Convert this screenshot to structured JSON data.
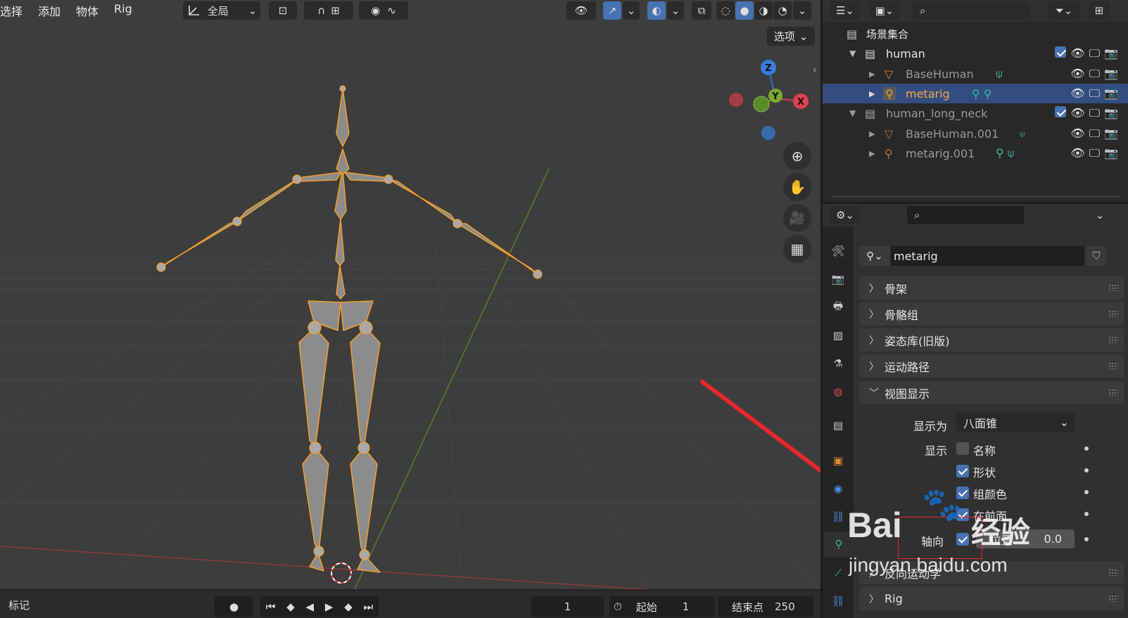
{
  "viewport": {
    "menu": [
      "选择",
      "添加",
      "物体",
      "Rig"
    ],
    "orientation_label": "全局",
    "options_label": "选项",
    "gizmo": {
      "z": "Z",
      "y": "Y",
      "x": "X"
    }
  },
  "timeline": {
    "label": "标记",
    "current_frame": "1",
    "start_label": "起始",
    "start_value": "1",
    "end_label": "结束点",
    "end_value": "250"
  },
  "outliner": {
    "scene_collection": "场景集合",
    "rows": [
      {
        "name": "human"
      },
      {
        "name": "BaseHuman"
      },
      {
        "name": "metarig"
      },
      {
        "name": "human_long_neck"
      },
      {
        "name": "BaseHuman.001"
      },
      {
        "name": "metarig.001"
      }
    ]
  },
  "properties": {
    "object_name": "metarig",
    "panels": [
      "骨架",
      "骨骼组",
      "姿态库(旧版)",
      "运动路径",
      "视图显示",
      "反向运动学",
      "Rig"
    ],
    "display_as_label": "显示为",
    "display_as_value": "八面锥",
    "show_label": "显示",
    "checkboxes": [
      {
        "label": "名称",
        "checked": false
      },
      {
        "label": "形状",
        "checked": true
      },
      {
        "label": "组颜色",
        "checked": true
      },
      {
        "label": "在前面",
        "checked": true
      },
      {
        "label": "轴向",
        "checked": true
      }
    ],
    "position_label": "位置",
    "position_value": "0.0"
  },
  "watermark": {
    "brand": "Bai",
    "brand_cn": "经验",
    "url": "jingyan.baidu.com"
  },
  "colors": {
    "accent": "#4772b3",
    "bone_outline": "#f0a030",
    "arrow": "#e8262b",
    "selected_row": "#334d80"
  }
}
